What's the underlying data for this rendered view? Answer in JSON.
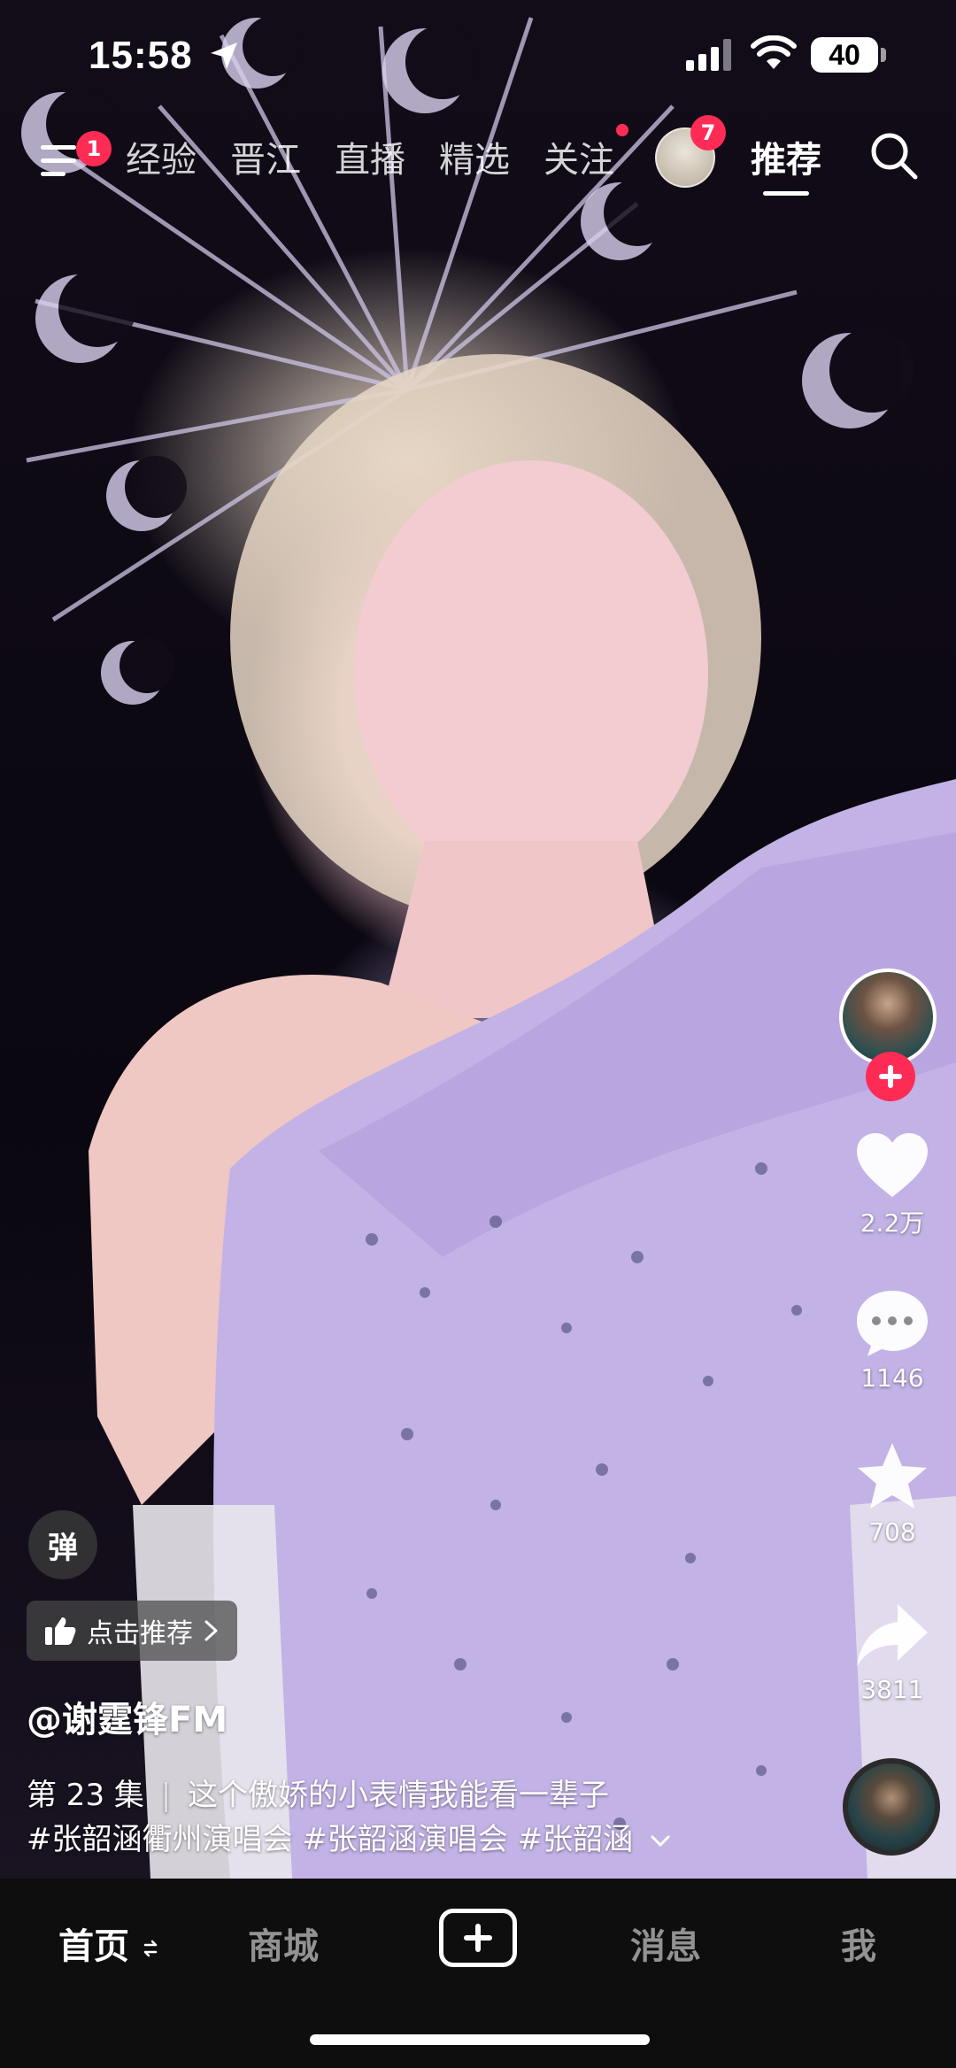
{
  "status_bar": {
    "time": "15:58",
    "battery": "40"
  },
  "top_nav": {
    "menu_badge": "1",
    "tabs": [
      "经验",
      "晋江",
      "直播",
      "精选",
      "关注"
    ],
    "avatar_badge": "7",
    "active_tab": "推荐"
  },
  "actions": {
    "likes": "2.2万",
    "comments": "1146",
    "favorites": "708",
    "shares": "3811"
  },
  "video_info": {
    "danmaku_label": "弹",
    "recommend_label": "点击推荐",
    "author": "@谢霆锋FM",
    "episode": "第 23 集",
    "caption": "这个傲娇的小表情我能看一辈子",
    "hashtags": "#张韶涵衢州演唱会 #张韶涵演唱会 #张韶涵"
  },
  "bottom_tabs": {
    "home": "首页",
    "mall": "商城",
    "messages": "消息",
    "me": "我"
  },
  "colors": {
    "accent": "#fe2c55",
    "tabbar_bg": "#0e0e0e"
  }
}
